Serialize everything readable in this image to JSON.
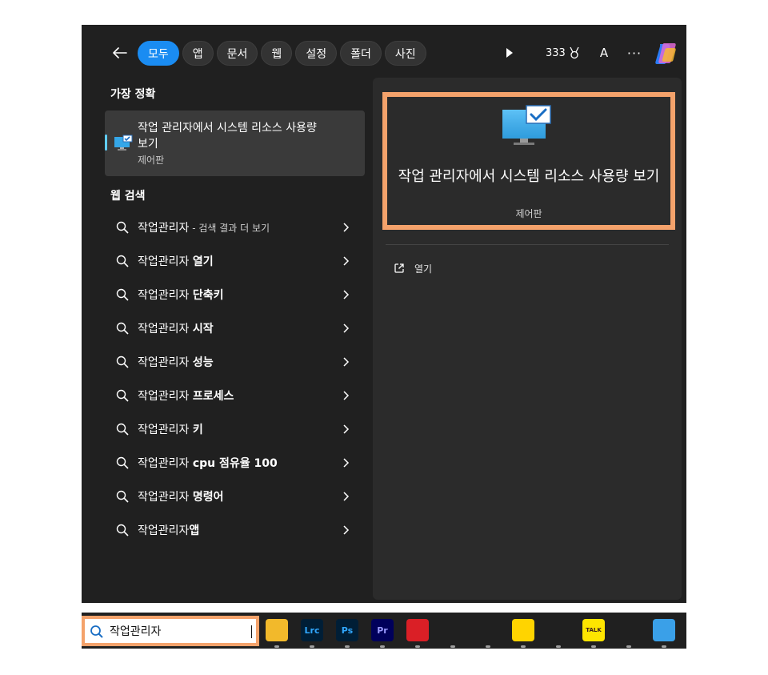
{
  "filters": {
    "back_label": "←",
    "chips": [
      "모두",
      "앱",
      "문서",
      "웹",
      "설정",
      "폴더",
      "사진"
    ],
    "points": "333"
  },
  "header": {
    "avatar_letter": "A",
    "more_label": "···"
  },
  "best_match": {
    "heading": "가장 정확",
    "title": "작업 관리자에서 시스템 리소스 사용량 보기",
    "subtitle": "제어판"
  },
  "web_search": {
    "heading": "웹 검색",
    "items": [
      {
        "prefix": "작업관리자",
        "suffix": "",
        "hint": " - 검색 결과 더 보기"
      },
      {
        "prefix": "작업관리자 ",
        "suffix": "열기",
        "hint": ""
      },
      {
        "prefix": "작업관리자 ",
        "suffix": "단축키",
        "hint": ""
      },
      {
        "prefix": "작업관리자 ",
        "suffix": "시작",
        "hint": ""
      },
      {
        "prefix": "작업관리자 ",
        "suffix": "성능",
        "hint": ""
      },
      {
        "prefix": "작업관리자 ",
        "suffix": "프로세스",
        "hint": ""
      },
      {
        "prefix": "작업관리자 ",
        "suffix": "키",
        "hint": ""
      },
      {
        "prefix": "작업관리자 ",
        "suffix": "cpu 점유율 100",
        "hint": ""
      },
      {
        "prefix": "작업관리자 ",
        "suffix": "명령어",
        "hint": ""
      },
      {
        "prefix": "작업관리자",
        "suffix": "앱",
        "hint": ""
      }
    ]
  },
  "preview": {
    "title": "작업 관리자에서 시스템 리소스 사용량 보기",
    "subtitle": "제어판",
    "open_label": "열기"
  },
  "taskbar": {
    "search_value": "작업관리자",
    "apps": [
      {
        "name": "file-explorer",
        "label": "",
        "bg": "#f2b92b",
        "fg": "#ffffff"
      },
      {
        "name": "lightroom-classic",
        "label": "Lrc",
        "bg": "#001e36",
        "fg": "#31a8ff"
      },
      {
        "name": "photoshop",
        "label": "Ps",
        "bg": "#001e36",
        "fg": "#31a8ff"
      },
      {
        "name": "premiere-pro",
        "label": "Pr",
        "bg": "#00005b",
        "fg": "#9999ff"
      },
      {
        "name": "creative-cloud",
        "label": "",
        "bg": "#da1f26",
        "fg": "#ffffff"
      },
      {
        "name": "davinci-resolve",
        "label": "",
        "bg": "#202020",
        "fg": "#ffffff"
      },
      {
        "name": "edge",
        "label": "",
        "bg": "#202020",
        "fg": "#ffffff"
      },
      {
        "name": "sticky-notes",
        "label": "",
        "bg": "#ffd400",
        "fg": "#000000"
      },
      {
        "name": "web-browser",
        "label": "",
        "bg": "#202020",
        "fg": "#ffffff"
      },
      {
        "name": "kakaotalk",
        "label": "TALK",
        "bg": "#fee500",
        "fg": "#3c1e1e"
      },
      {
        "name": "utility-app",
        "label": "",
        "bg": "#202020",
        "fg": "#ffffff"
      },
      {
        "name": "notepad",
        "label": "",
        "bg": "#3aa0e8",
        "fg": "#ffffff"
      }
    ]
  },
  "colors": {
    "accent": "#1a8cf2",
    "highlight_outline": "#f4a26b",
    "panel_bg": "#202020"
  }
}
